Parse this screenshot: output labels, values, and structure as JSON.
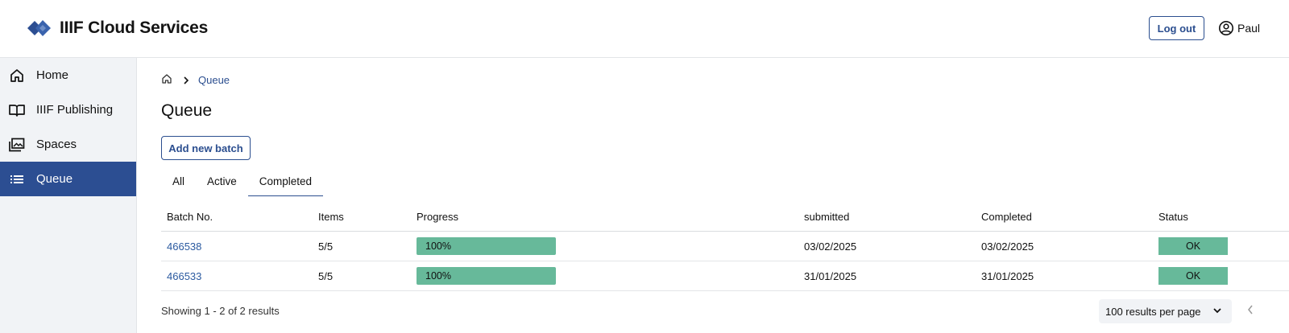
{
  "header": {
    "app_title": "IIIF Cloud Services",
    "logout_label": "Log out",
    "user_name": "Paul",
    "brand_color": "#2c4e92"
  },
  "sidebar": {
    "items": [
      {
        "label": "Home",
        "icon": "home-icon"
      },
      {
        "label": "IIIF Publishing",
        "icon": "book-open-icon"
      },
      {
        "label": "Spaces",
        "icon": "images-icon"
      },
      {
        "label": "Queue",
        "icon": "list-icon",
        "active": true
      }
    ]
  },
  "main": {
    "breadcrumb": {
      "home_icon": "home-icon",
      "current": "Queue"
    },
    "title": "Queue",
    "add_button_label": "Add new batch",
    "tabs": [
      {
        "label": "All"
      },
      {
        "label": "Active"
      },
      {
        "label": "Completed",
        "active": true
      }
    ],
    "table": {
      "columns": [
        "Batch No.",
        "Items",
        "Progress",
        "submitted",
        "Completed",
        "Status"
      ],
      "rows": [
        {
          "batch": "466538",
          "items": "5/5",
          "progress": "100%",
          "submitted": "03/02/2025",
          "completed": "03/02/2025",
          "status": "OK"
        },
        {
          "batch": "466533",
          "items": "5/5",
          "progress": "100%",
          "submitted": "31/01/2025",
          "completed": "31/01/2025",
          "status": "OK"
        }
      ],
      "status_color": "#67b99a"
    },
    "results_text": "Showing 1 - 2 of 2 results",
    "per_page_label": "100 results per page"
  }
}
